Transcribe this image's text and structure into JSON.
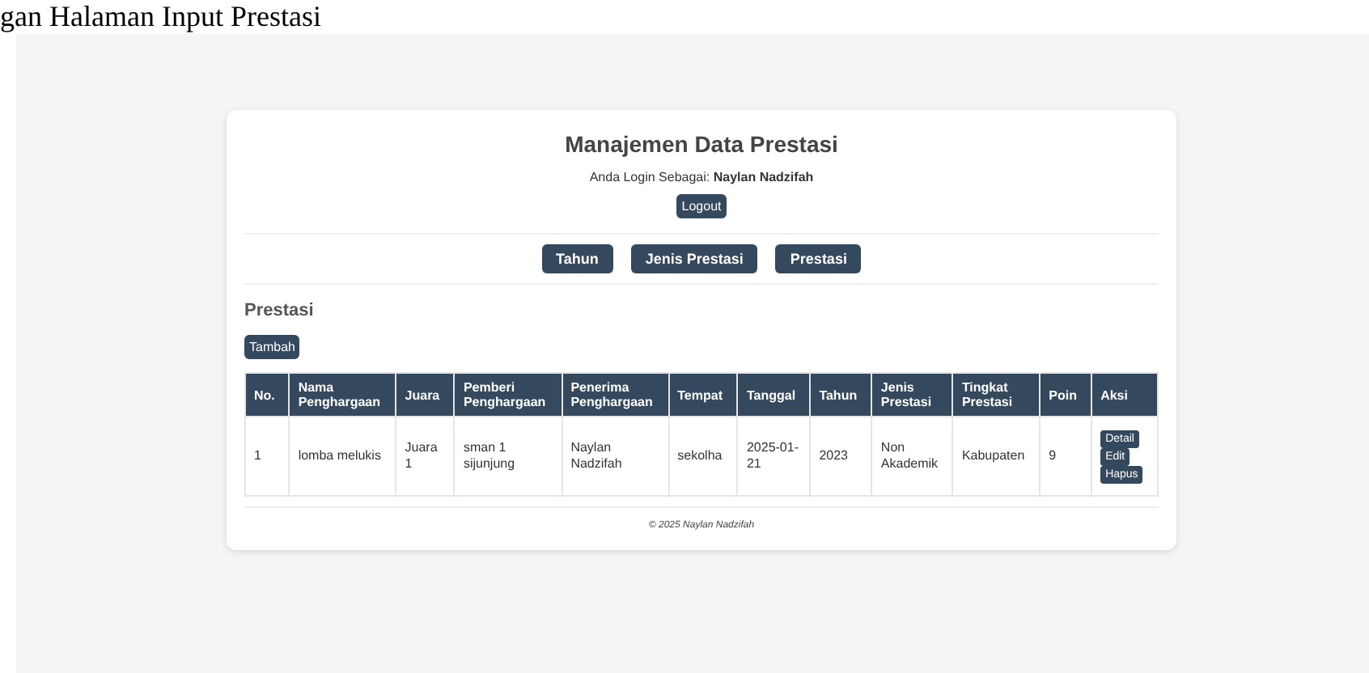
{
  "caption": "gan Halaman Input Prestasi",
  "header": {
    "title": "Manajemen Data Prestasi",
    "login_label": "Anda Login Sebagai:",
    "user": "Naylan Nadzifah",
    "logout": "Logout"
  },
  "nav": [
    "Tahun",
    "Jenis Prestasi",
    "Prestasi"
  ],
  "section_title": "Prestasi",
  "add_button": "Tambah",
  "table": {
    "columns": [
      "No.",
      "Nama Penghargaan",
      "Juara",
      "Pemberi Penghargaan",
      "Penerima Penghargaan",
      "Tempat",
      "Tanggal",
      "Tahun",
      "Jenis Prestasi",
      "Tingkat Prestasi",
      "Poin",
      "Aksi"
    ],
    "rows": [
      {
        "cells": [
          "1",
          "lomba melukis",
          "Juara 1",
          "sman 1 sijunjung",
          "Naylan Nadzifah",
          "sekolha",
          "2025-01-21",
          "2023",
          "Non Akademik",
          "Kabupaten",
          "9"
        ],
        "actions": [
          "Detail",
          "Edit",
          "Hapus"
        ]
      }
    ]
  },
  "footer": "© 2025 Naylan Nadzifah"
}
